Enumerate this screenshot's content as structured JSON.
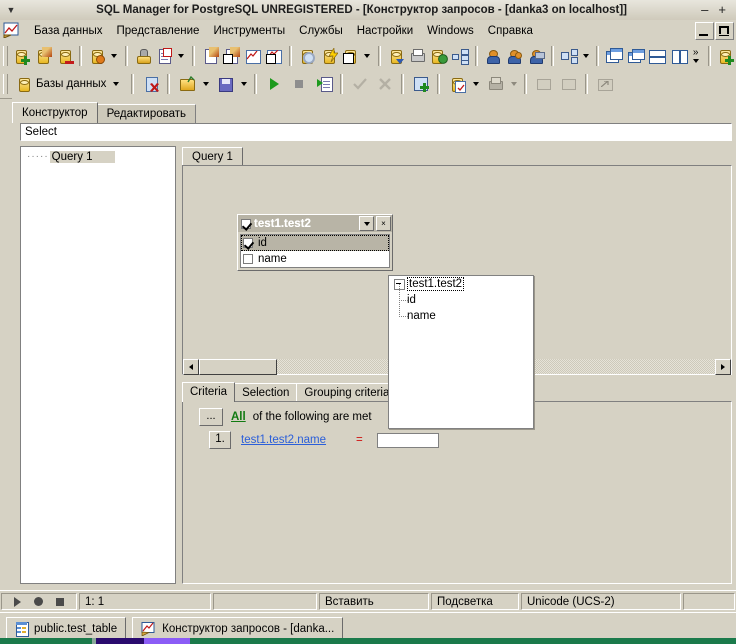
{
  "window": {
    "title": "SQL Manager for PostgreSQL UNREGISTERED - [Конструктор запросов - [danka3 on localhost]]",
    "menu_dot": "▼",
    "minimize": "–",
    "maximize": "+"
  },
  "menubar": {
    "items": [
      {
        "label": "База данных",
        "name": "menu-database"
      },
      {
        "label": "Представление",
        "name": "menu-view"
      },
      {
        "label": "Инструменты",
        "name": "menu-tools"
      },
      {
        "label": "Службы",
        "name": "menu-services"
      },
      {
        "label": "Настройки",
        "name": "menu-options"
      },
      {
        "label": "Windows",
        "name": "menu-windows"
      },
      {
        "label": "Справка",
        "name": "menu-help"
      }
    ]
  },
  "toolbar1": {
    "icons": [
      "new-database-icon",
      "edit-database-icon",
      "drop-database-icon",
      "database-properties-icon",
      "dropdown-arrow-icon",
      "register-host-icon",
      "tasks-icon",
      "dropdown-arrow-icon",
      "new-query-icon",
      "new-query-add-icon",
      "query-designer-icon",
      "query-designer-add-icon",
      "search-database-icon",
      "sql-script-icon",
      "new-object-icon",
      "dropdown-arrow-icon",
      "extract-database-icon",
      "print-icon",
      "export-database-icon",
      "dependency-tree-icon",
      "user-icon",
      "user-manager-icon",
      "user-privileges-icon",
      "diagram-icon",
      "dropdown-arrow-icon",
      "cascade-windows-icon",
      "tile-windows-icon",
      "tile-horizontal-icon",
      "tile-vertical-icon"
    ],
    "overflow": "»"
  },
  "toolbar2": {
    "db_selector_label": "Базы данных",
    "icons": [
      "database-icon",
      "dropdown-arrow-icon",
      "close-query-icon",
      "open-file-icon",
      "dropdown-arrow-icon",
      "save-file-icon",
      "dropdown-arrow-icon",
      "run-query-icon",
      "stop-query-icon",
      "run-script-icon",
      "commit-icon",
      "rollback-icon",
      "add-table-icon",
      "favorite-query-icon",
      "dropdown-arrow-icon",
      "print-query-icon",
      "dropdown-arrow-icon",
      "previous-result-icon",
      "next-result-icon",
      "fullscreen-icon"
    ]
  },
  "page_tabs": [
    {
      "label": "Конструктор",
      "active": true,
      "name": "tab-designer"
    },
    {
      "label": "Редактировать",
      "active": false,
      "name": "tab-edit"
    }
  ],
  "select_bar": {
    "text": "Select"
  },
  "left_tree": {
    "items": [
      {
        "label": "Query 1",
        "selected": true
      }
    ]
  },
  "query_tabs": [
    {
      "label": "Query 1",
      "active": true
    }
  ],
  "canvas": {
    "table_box": {
      "title": "test1.test2",
      "title_checked": true,
      "dropdown_icon": "▼",
      "close_icon": "×",
      "fields": [
        {
          "name": "id",
          "checked": true,
          "selected": true
        },
        {
          "name": "name",
          "checked": false,
          "selected": false
        }
      ]
    },
    "hscroll": {
      "left_arrow": "◀",
      "right_arrow": "▶"
    }
  },
  "popup_tree": {
    "root": {
      "label": "test1.test2",
      "expander": "−"
    },
    "children": [
      {
        "label": "id"
      },
      {
        "label": "name"
      }
    ]
  },
  "criteria": {
    "tabs": [
      {
        "label": "Criteria",
        "active": true,
        "name": "tab-criteria"
      },
      {
        "label": "Selection",
        "active": false,
        "name": "tab-selection"
      },
      {
        "label": "Grouping criteria",
        "active": false,
        "name": "tab-grouping-criteria"
      }
    ],
    "header": {
      "dots_button": "...",
      "all_link": "All",
      "text": "of the following are met"
    },
    "rows": [
      {
        "number": "1.",
        "field": "test1.test2.name",
        "operator": "=",
        "value": ""
      }
    ]
  },
  "statusbar": {
    "controls": [
      "play-icon",
      "record-icon",
      "stop-icon"
    ],
    "cells": [
      "1:  1",
      "",
      "Вставить",
      "Подсветка",
      "Unicode (UCS-2)",
      ""
    ]
  },
  "taskbar": {
    "items": [
      {
        "label": "public.test_table",
        "icon": "table-icon"
      },
      {
        "label": "Конструктор запросов - [danka...",
        "icon": "query-designer-icon"
      }
    ]
  },
  "colors": {
    "face": "#d6d2c4",
    "title_text": "#1c1c1c",
    "link_blue": "#2b5fd9",
    "link_green": "#117a11",
    "operator_red": "#d01010",
    "selection": "#b8b4a6"
  }
}
